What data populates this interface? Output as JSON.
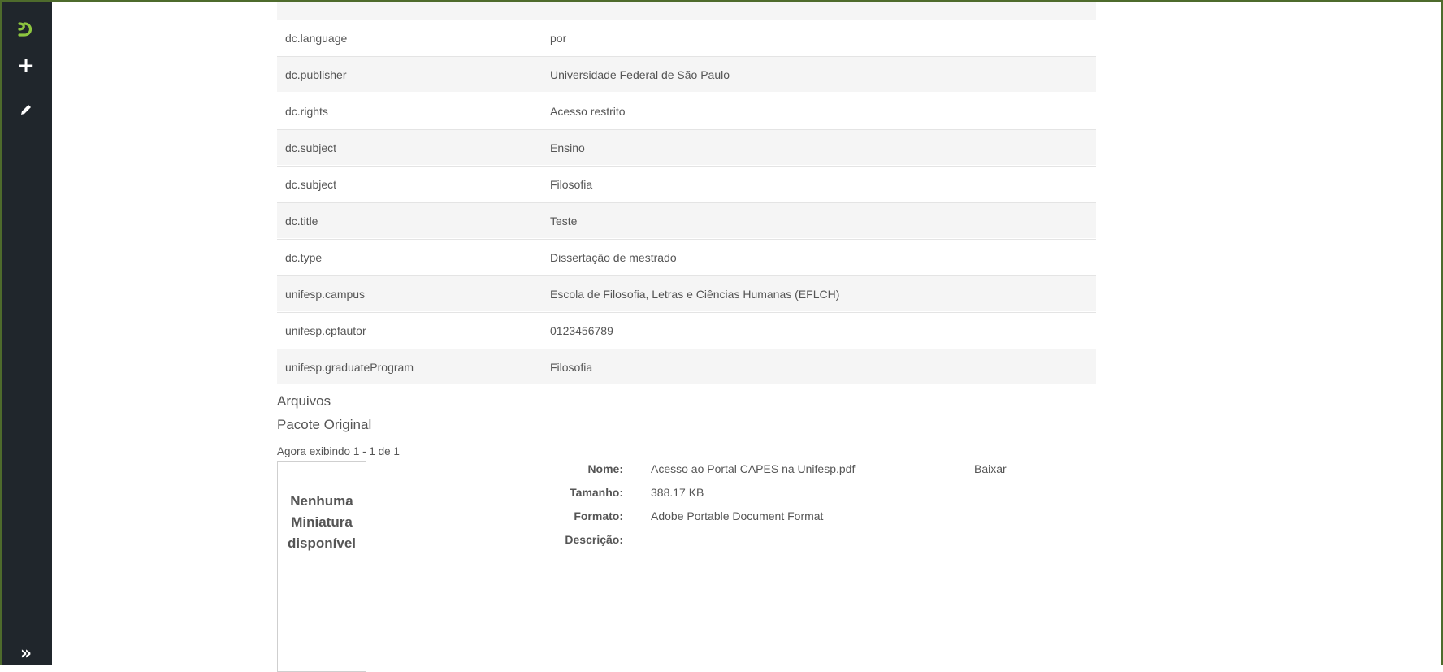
{
  "sidebar": {
    "icons": [
      "logo-icon",
      "plus-icon",
      "pencil-icon",
      "expand-icon"
    ],
    "plus_glyph": "+",
    "expand_glyph": "»"
  },
  "metadata_rows": [
    {
      "key": "dc.language",
      "value": "por"
    },
    {
      "key": "dc.publisher",
      "value": "Universidade Federal de São Paulo"
    },
    {
      "key": "dc.rights",
      "value": "Acesso restrito"
    },
    {
      "key": "dc.subject",
      "value": "Ensino"
    },
    {
      "key": "dc.subject",
      "value": "Filosofia"
    },
    {
      "key": "dc.title",
      "value": "Teste"
    },
    {
      "key": "dc.type",
      "value": "Dissertação de mestrado"
    },
    {
      "key": "unifesp.campus",
      "value": "Escola de Filosofia, Letras e Ciências Humanas (EFLCH)"
    },
    {
      "key": "unifesp.cpfautor",
      "value": "0123456789"
    },
    {
      "key": "unifesp.graduateProgram",
      "value": "Filosofia"
    }
  ],
  "files": {
    "heading": "Arquivos",
    "bundle": "Pacote Original",
    "showing": "Agora exibindo 1 - 1 de 1",
    "thumbnail": {
      "line1": "Nenhuma",
      "line2": "Miniatura",
      "line3": "disponível"
    },
    "labels": {
      "name": "Nome:",
      "size": "Tamanho:",
      "format": "Formato:",
      "description": "Descrição:"
    },
    "file": {
      "name": "Acesso ao Portal CAPES na Unifesp.pdf",
      "size": "388.17 KB",
      "format": "Adobe Portable Document Format",
      "description": ""
    },
    "download_label": "Baixar"
  },
  "colors": {
    "sidebar": "#20262c",
    "accent": "#8dc63f",
    "frame": "#4e6b2c",
    "row_stripe": "#f5f5f5"
  }
}
